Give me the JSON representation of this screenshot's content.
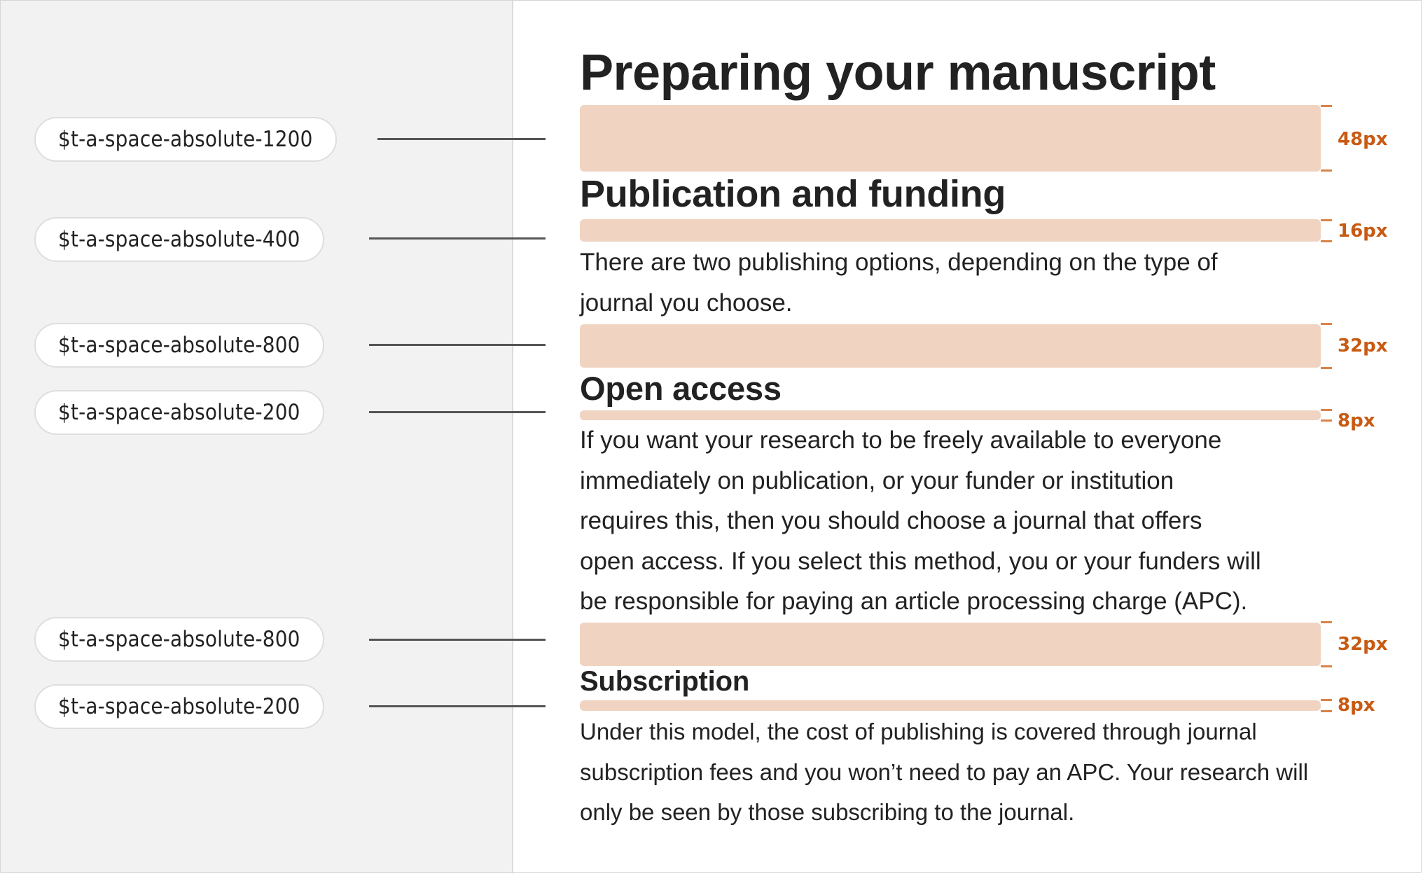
{
  "tokens": [
    {
      "name": "$t-a-space-absolute-1200",
      "value": "48px"
    },
    {
      "name": "$t-a-space-absolute-400",
      "value": "16px"
    },
    {
      "name": "$t-a-space-absolute-800",
      "value": "32px"
    },
    {
      "name": "$t-a-space-absolute-200",
      "value": "8px"
    },
    {
      "name": "$t-a-space-absolute-800",
      "value": "32px"
    },
    {
      "name": "$t-a-space-absolute-200",
      "value": "8px"
    }
  ],
  "content": {
    "title": "Preparing your manuscript",
    "section_heading": "Publication and funding",
    "section_paragraph": [
      "There are two publishing options, depending on the type of",
      "journal you choose."
    ],
    "open_access_heading": "Open access",
    "open_access_paragraph": [
      "If you want your research to be freely available to everyone",
      "immediately on publication, or your funder or institution",
      "requires this, then you should choose a journal that offers",
      "open access. If you select this method, you or your funders will",
      "be responsible for paying an article processing charge (APC)."
    ],
    "subscription_heading": "Subscription",
    "subscription_paragraph": [
      "Under this model, the cost of publishing is covered through journal",
      "subscription fees and you won’t need to pay an APC. Your research will",
      "only be seen by those subscribing to the journal."
    ]
  },
  "colors": {
    "spacing_band": "#f0d4c1",
    "measure_label": "#c85a12",
    "bracket": "#d9834a",
    "left_panel": "#f2f2f2",
    "connector": "#555555"
  }
}
